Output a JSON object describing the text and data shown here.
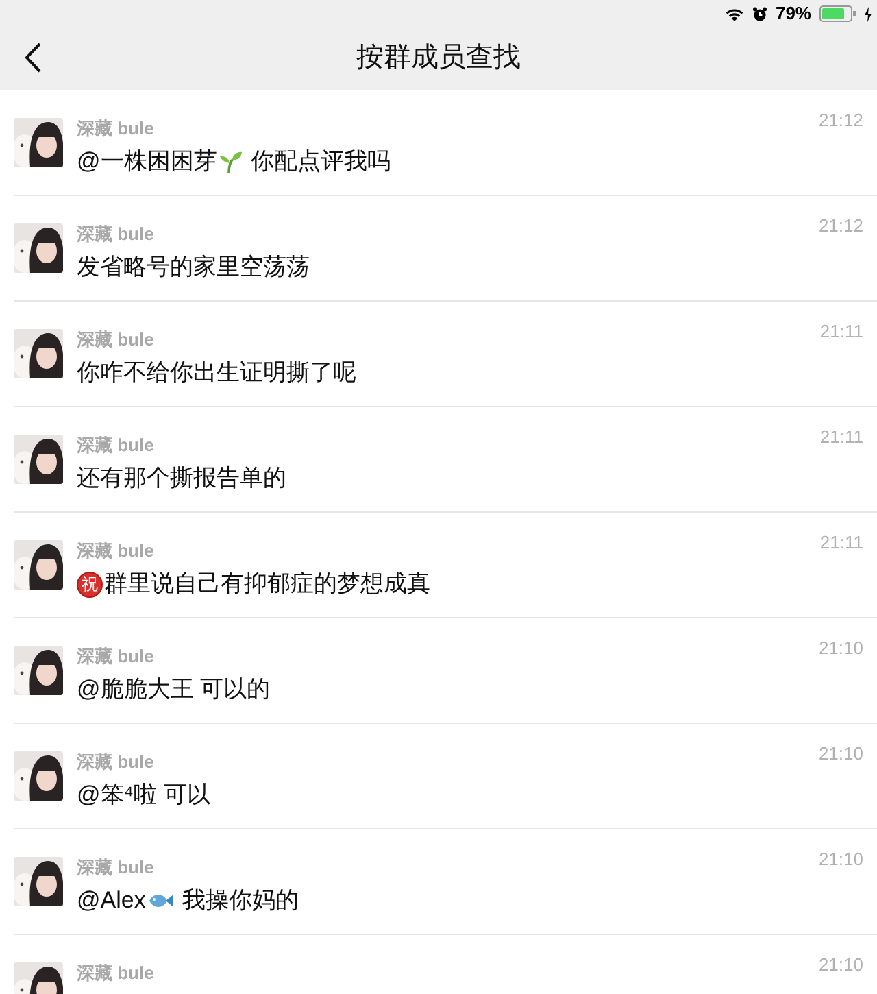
{
  "status_bar": {
    "battery": "79%"
  },
  "nav": {
    "title": "按群成员查找"
  },
  "messages": [
    {
      "name": "深藏 bule",
      "time": "21:12",
      "parts": [
        {
          "kind": "text",
          "text": "@一株困困芽"
        },
        {
          "kind": "sprout"
        },
        {
          "kind": "text",
          "text": " 你配点评我吗"
        }
      ]
    },
    {
      "name": "深藏 bule",
      "time": "21:12",
      "parts": [
        {
          "kind": "text",
          "text": "发省略号的家里空荡荡"
        }
      ]
    },
    {
      "name": "深藏 bule",
      "time": "21:11",
      "parts": [
        {
          "kind": "text",
          "text": "你咋不给你出生证明撕了呢"
        }
      ]
    },
    {
      "name": "深藏 bule",
      "time": "21:11",
      "parts": [
        {
          "kind": "text",
          "text": "还有那个撕报告单的"
        }
      ]
    },
    {
      "name": "深藏 bule",
      "time": "21:11",
      "parts": [
        {
          "kind": "badge",
          "text": "祝"
        },
        {
          "kind": "text",
          "text": "群里说自己有抑郁症的梦想成真"
        }
      ]
    },
    {
      "name": "深藏 bule",
      "time": "21:10",
      "parts": [
        {
          "kind": "text",
          "text": "@脆脆大王 可以的"
        }
      ]
    },
    {
      "name": "深藏 bule",
      "time": "21:10",
      "parts": [
        {
          "kind": "text",
          "text": "@笨⁴啦 可以"
        }
      ]
    },
    {
      "name": "深藏 bule",
      "time": "21:10",
      "parts": [
        {
          "kind": "text",
          "text": "@Alex"
        },
        {
          "kind": "fish"
        },
        {
          "kind": "text",
          "text": " 我操你妈的"
        }
      ]
    },
    {
      "name": "深藏 bule",
      "time": "21:10"
    }
  ]
}
